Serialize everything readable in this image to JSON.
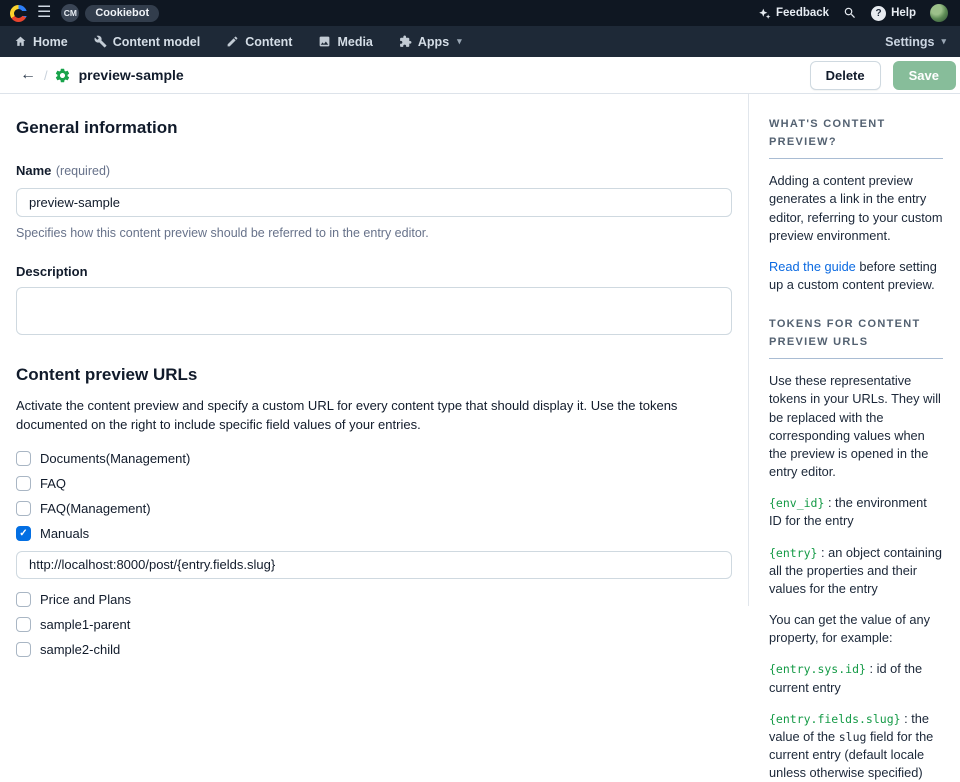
{
  "topbar": {
    "space_initials": "CM",
    "space_name": "Cookiebot",
    "feedback_label": "Feedback",
    "help_label": "Help",
    "help_glyph": "?"
  },
  "nav": {
    "items": [
      {
        "label": "Home",
        "icon": "home-icon",
        "caret": false
      },
      {
        "label": "Content model",
        "icon": "wrench-icon",
        "caret": false
      },
      {
        "label": "Content",
        "icon": "pencil-icon",
        "caret": false
      },
      {
        "label": "Media",
        "icon": "image-icon",
        "caret": false
      },
      {
        "label": "Apps",
        "icon": "puzzle-icon",
        "caret": true
      }
    ],
    "settings_label": "Settings"
  },
  "header": {
    "title": "preview-sample",
    "delete_label": "Delete",
    "save_label": "Save"
  },
  "general": {
    "heading": "General information",
    "name_label": "Name",
    "name_required": "(required)",
    "name_value": "preview-sample",
    "name_help": "Specifies how this content preview should be referred to in the entry editor.",
    "description_label": "Description",
    "description_value": ""
  },
  "preview_urls": {
    "heading": "Content preview URLs",
    "description": "Activate the content preview and specify a custom URL for every content type that should display it. Use the tokens documented on the right to include specific field values of your entries.",
    "content_types": [
      {
        "label": "Documents(Management)",
        "checked": false
      },
      {
        "label": "FAQ",
        "checked": false
      },
      {
        "label": "FAQ(Management)",
        "checked": false
      },
      {
        "label": "Manuals",
        "checked": true,
        "url": "http://localhost:8000/post/{entry.fields.slug}"
      },
      {
        "label": "Price and Plans",
        "checked": false
      },
      {
        "label": "sample1-parent",
        "checked": false
      },
      {
        "label": "sample2-child",
        "checked": false
      }
    ]
  },
  "sidebar": {
    "whats_preview": {
      "heading": "WHAT'S CONTENT PREVIEW?",
      "para1": "Adding a content preview generates a link in the entry editor, referring to your custom preview environment.",
      "link_text": "Read the guide",
      "para2_rest": " before setting up a custom content preview."
    },
    "tokens_section": {
      "heading": "TOKENS FOR CONTENT PREVIEW URLS",
      "intro": "Use these representative tokens in your URLs. They will be replaced with the corresponding values when the preview is opened in the entry editor.",
      "tokens1": [
        {
          "code": "{env_id}",
          "d1": " : the environment ID for the entry"
        },
        {
          "code": "{entry}",
          "d1": " : an object containing all the properties and their values for the entry"
        }
      ],
      "middle": "You can get the value of any property, for example:",
      "tokens2": [
        {
          "code": "{entry.sys.id}",
          "d1": " : id of the current entry"
        },
        {
          "code": "{entry.fields.slug}",
          "d1": " : the value of the ",
          "mono": "slug",
          "d2": " field for the current entry (default locale unless otherwise specified)"
        }
      ]
    }
  },
  "colors": {
    "topbar_bg": "#0f1722",
    "nav_bg": "#1e2937",
    "accent_blue": "#036fe3",
    "link_blue": "#0b6ae1",
    "brand_green": "#18a34a",
    "token_green": "#149a46",
    "save_button_green": "#87bd9a"
  }
}
